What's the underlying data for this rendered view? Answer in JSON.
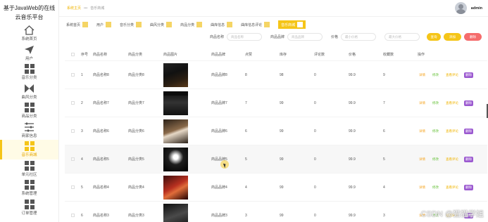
{
  "brand": "基于JavaWeb的在线云音乐平台",
  "sidebar": {
    "items": [
      {
        "label": "系统首页",
        "icon": "home-icon",
        "active": false
      },
      {
        "label": "用户",
        "icon": "send-icon",
        "active": false
      },
      {
        "label": "音乐分类",
        "icon": "grid-icon",
        "active": false
      },
      {
        "label": "曲风分类",
        "icon": "butterfly-icon",
        "active": false
      },
      {
        "label": "商品分类",
        "icon": "grid-icon",
        "active": false
      },
      {
        "label": "商家信息",
        "icon": "sliders-icon",
        "active": false
      },
      {
        "label": "音乐商城",
        "icon": "grid-icon",
        "active": true
      },
      {
        "label": "单元社区",
        "icon": "grid-icon",
        "active": false
      },
      {
        "label": "系统管理",
        "icon": "grid-icon",
        "active": false
      },
      {
        "label": "订单管理",
        "icon": "grid-icon",
        "active": false
      }
    ]
  },
  "breadcrumb": {
    "home": "系统主页",
    "sep": "•••",
    "current": "音乐商城"
  },
  "user": {
    "name": "admin"
  },
  "tabs": [
    {
      "label": "系统首页",
      "active": false
    },
    {
      "label": "用户",
      "active": false
    },
    {
      "label": "音乐分类",
      "active": false
    },
    {
      "label": "曲风分类",
      "active": false
    },
    {
      "label": "商品分类",
      "active": false
    },
    {
      "label": "曲库信息",
      "active": false
    },
    {
      "label": "曲库信息评论",
      "active": false
    },
    {
      "label": "音乐商城",
      "active": true
    }
  ],
  "search": {
    "name_label": "商品名称",
    "name_placeholder": "商品名称",
    "brand_label": "商品品牌",
    "brand_placeholder": "商品品牌",
    "price_label": "价格",
    "price_min_placeholder": "最小价格",
    "price_max_placeholder": "最大价格",
    "search_btn": "查询",
    "add_btn": "添加",
    "del_btn": "删除"
  },
  "table": {
    "headers": [
      "序号",
      "商品名称",
      "商品分类",
      "商品图片",
      "商品品牌",
      "点赞",
      "库存",
      "评论数",
      "价格",
      "收藏数",
      "操作"
    ],
    "ops": {
      "detail": "详情",
      "edit": "修改",
      "review": "查看评论",
      "del": "删除"
    },
    "rows": [
      {
        "idx": "1",
        "name": "商品名称8",
        "cat": "商品分类8",
        "brand": "商品品牌8",
        "like": "8",
        "stock": "98",
        "comment": "0",
        "price": "99.9",
        "coll": "9"
      },
      {
        "idx": "2",
        "name": "商品名称7",
        "cat": "商品分类7",
        "brand": "商品品牌7",
        "like": "7",
        "stock": "99",
        "comment": "0",
        "price": "99.9",
        "coll": "7"
      },
      {
        "idx": "3",
        "name": "商品名称6",
        "cat": "商品分类6",
        "brand": "商品品牌6",
        "like": "6",
        "stock": "99",
        "comment": "0",
        "price": "99.9",
        "coll": "6"
      },
      {
        "idx": "4",
        "name": "商品名称5",
        "cat": "商品分类5",
        "brand": "商品品牌5",
        "like": "5",
        "stock": "99",
        "comment": "0",
        "price": "99.9",
        "coll": "5"
      },
      {
        "idx": "5",
        "name": "商品名称4",
        "cat": "商品分类4",
        "brand": "商品品牌4",
        "like": "4",
        "stock": "99",
        "comment": "0",
        "price": "99.9",
        "coll": "4"
      },
      {
        "idx": "6",
        "name": "商品名称3",
        "cat": "商品分类3",
        "brand": "商品品牌3",
        "like": "3",
        "stock": "99",
        "comment": "0",
        "price": "99.9",
        "coll": "3"
      }
    ]
  },
  "watermark": "CSDN @猫猫学姐"
}
